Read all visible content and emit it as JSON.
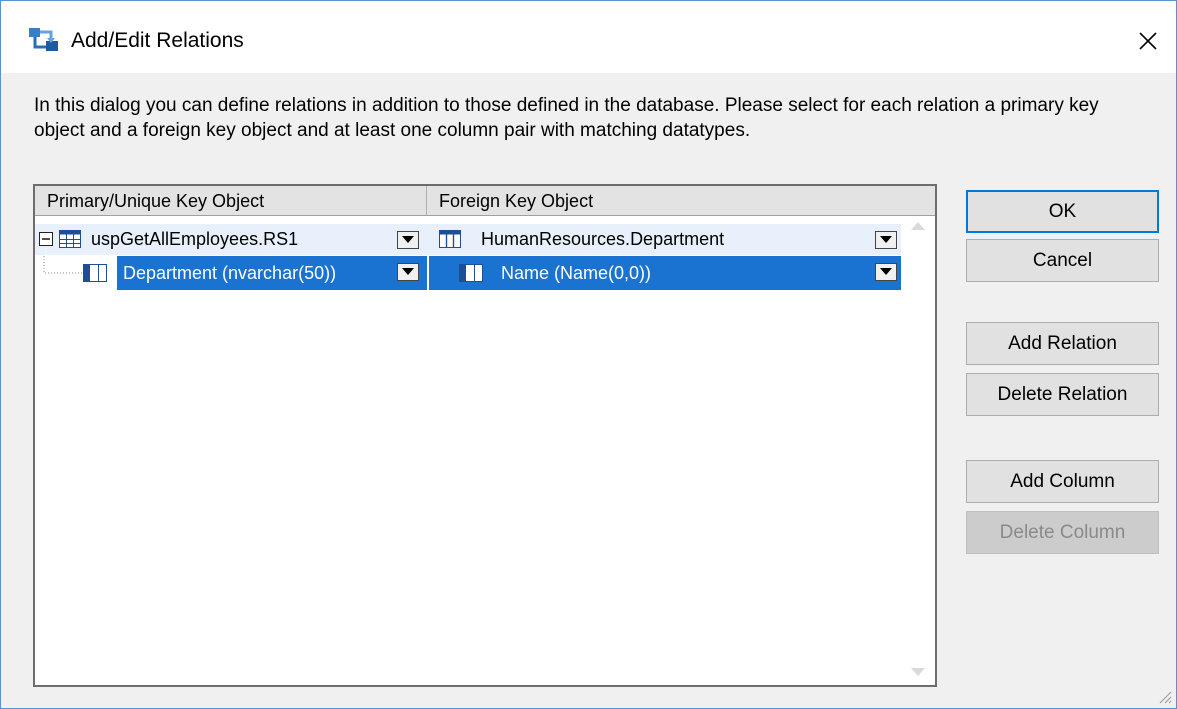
{
  "window": {
    "title": "Add/Edit Relations",
    "icon": "relations-icon",
    "close_icon": "close-icon"
  },
  "description": "In this dialog you can define relations in addition to those defined in the database.  Please select for each relation a primary key object and a foreign key object and at least one column pair with matching datatypes.",
  "grid": {
    "columns": [
      "Primary/Unique Key Object",
      "Foreign Key Object"
    ],
    "rows": [
      {
        "expanded": true,
        "primary": {
          "icon": "table-icon",
          "label": "uspGetAllEmployees.RS1"
        },
        "foreign": {
          "icon": "table-columns-icon",
          "label": "HumanResources.Department"
        },
        "selected": false
      },
      {
        "primary": {
          "icon": "column-icon",
          "label": "Department (nvarchar(50))"
        },
        "foreign": {
          "icon": "column-icon",
          "label": "Name (Name(0,0))"
        },
        "selected": true
      }
    ]
  },
  "buttons": {
    "ok": "OK",
    "cancel": "Cancel",
    "add_relation": "Add Relation",
    "delete_relation": "Delete Relation",
    "add_column": "Add Column",
    "delete_column": "Delete Column"
  },
  "colors": {
    "selection": "#1a73d1",
    "accent": "#0078d7",
    "row_highlight": "#e8f1fb"
  }
}
